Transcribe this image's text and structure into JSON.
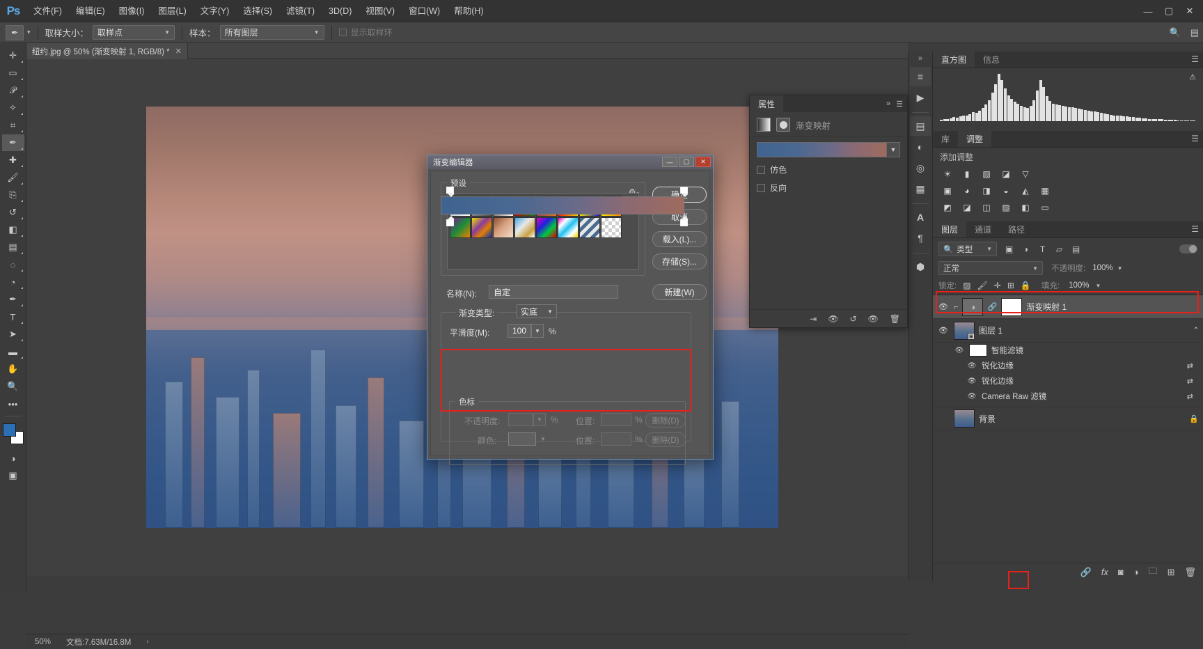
{
  "app": {
    "logo": "Ps"
  },
  "menubar": {
    "items": [
      {
        "label": "文件(F)"
      },
      {
        "label": "编辑(E)"
      },
      {
        "label": "图像(I)"
      },
      {
        "label": "图层(L)"
      },
      {
        "label": "文字(Y)"
      },
      {
        "label": "选择(S)"
      },
      {
        "label": "滤镜(T)"
      },
      {
        "label": "3D(D)"
      },
      {
        "label": "视图(V)"
      },
      {
        "label": "窗口(W)"
      },
      {
        "label": "帮助(H)"
      }
    ],
    "window_controls": {
      "minimize": "—",
      "maximize": "▢",
      "close": "✕"
    }
  },
  "optionsbar": {
    "tool_icon": "eyedropper-icon",
    "sample_size_label": "取样大小：",
    "sample_size_value": "取样点",
    "sample_label": "样本：",
    "sample_value": "所有图层",
    "show_ring_label": "显示取样环",
    "search_icon": "search-icon",
    "arrange_icon": "workspace-icon"
  },
  "toolbar": {
    "tools": [
      {
        "name": "move-tool",
        "glyph": "✛"
      },
      {
        "name": "marquee-tool",
        "glyph": "▭"
      },
      {
        "name": "lasso-tool",
        "glyph": "🄿"
      },
      {
        "name": "quick-select-tool",
        "glyph": "✧"
      },
      {
        "name": "crop-tool",
        "glyph": "⌗"
      },
      {
        "name": "eyedropper-tool",
        "glyph": "✎"
      },
      {
        "name": "healing-brush-tool",
        "glyph": "✚"
      },
      {
        "name": "brush-tool",
        "glyph": "🖌"
      },
      {
        "name": "clone-stamp-tool",
        "glyph": "⎘"
      },
      {
        "name": "history-brush-tool",
        "glyph": "↺"
      },
      {
        "name": "eraser-tool",
        "glyph": "◧"
      },
      {
        "name": "gradient-tool",
        "glyph": "▤"
      },
      {
        "name": "blur-tool",
        "glyph": "◌"
      },
      {
        "name": "dodge-tool",
        "glyph": "🔍"
      },
      {
        "name": "pen-tool",
        "glyph": "✒"
      },
      {
        "name": "type-tool",
        "glyph": "T"
      },
      {
        "name": "path-select-tool",
        "glyph": "➤"
      },
      {
        "name": "shape-tool",
        "glyph": "▬"
      },
      {
        "name": "hand-tool",
        "glyph": "✋"
      },
      {
        "name": "zoom-tool",
        "glyph": "🔎"
      },
      {
        "name": "more-tools",
        "glyph": "•••"
      }
    ],
    "foreground_color": "#2c6fb5",
    "background_color": "#ffffff",
    "quickmask_glyph": "◑",
    "screenmode_glyph": "▣"
  },
  "document": {
    "tab_title": "纽约.jpg @ 50% (渐变映射 1, RGB/8) *",
    "close_glyph": "✕"
  },
  "statusbar": {
    "zoom": "50%",
    "doc_info": "文档:7.63M/16.8M",
    "arrow": "›"
  },
  "dialog": {
    "title": "渐变编辑器",
    "window_controls": {
      "minimize": "—",
      "maximize": "▢",
      "close": "✕"
    },
    "presets_legend": "预设",
    "gear_icon": "gear-icon",
    "presets": [
      {
        "name": "foreground-to-background",
        "css": "linear-gradient(135deg,#7ba0c8 0%,#ffffff 100%)"
      },
      {
        "name": "foreground-to-transparent",
        "css": "linear-gradient(135deg,#9db9d8 0%,rgba(255,255,255,0) 100%)"
      },
      {
        "name": "black-white",
        "css": "linear-gradient(135deg,#000000 0%,#ffffff 100%)"
      },
      {
        "name": "red-green",
        "css": "linear-gradient(135deg,#e00000 0%,#c00000 45%,#0a7a20 100%)"
      },
      {
        "name": "violet-orange",
        "css": "linear-gradient(135deg,#3a1a8c 0%,#7a3a6a 40%,#e07a10 100%)"
      },
      {
        "name": "blue-red-yellow",
        "css": "linear-gradient(135deg,#1414c8 0%,#e81010 45%,#f0d000 100%)"
      },
      {
        "name": "blue-yellow-blue",
        "css": "linear-gradient(135deg,#1414c8 0%,#f0e000 50%,#1414c8 100%)"
      },
      {
        "name": "orange-yellow-orange",
        "css": "linear-gradient(135deg,#f08000 0%,#ffe000 50%,#f08000 100%)"
      },
      {
        "name": "violet-green-orange",
        "css": "linear-gradient(135deg,#7a1a8c 0%,#1a8c3a 50%,#f08000 100%)"
      },
      {
        "name": "yellow-violet-orange-blue",
        "css": "linear-gradient(135deg,#f0e000 0%,#8a3aa0 40%,#e08000 65%,#1030b0 100%)"
      },
      {
        "name": "copper",
        "css": "linear-gradient(135deg,#8a5030 0%,#d8a080 45%,#f0ddc8 100%)"
      },
      {
        "name": "chrome",
        "css": "linear-gradient(135deg,#48a8e0 0%,#e8e8e8 40%,#c8a040 75%,#ffffff 100%)"
      },
      {
        "name": "spectrum",
        "css": "linear-gradient(135deg,#e000c0 0%,#2020e0 35%,#00c840 65%,#e00000 100%)"
      },
      {
        "name": "transparent-rainbow",
        "css": "linear-gradient(135deg,#e000c0 0%,#ffffff 25%,#20c0f0 50%,#ffffff 75%,#f0d000 100%)"
      },
      {
        "name": "transparent-stripes",
        "css": "repeating-linear-gradient(135deg,#4a6a90 0 5px,#e8e8e8 5px 10px)"
      },
      {
        "name": "checkerboard",
        "css": "repeating-conic-gradient(#cfcfcf 0% 25%,#ffffff 0% 50%) 0 0/10px 10px"
      }
    ],
    "name_label": "名称(N):",
    "name_value": "自定",
    "new_button": "新建(W)",
    "gradient_type_label": "渐变类型:",
    "gradient_type_value": "实底",
    "smoothness_label": "平滑度(M):",
    "smoothness_value": "100",
    "smoothness_unit": "%",
    "stops_legend": "色标",
    "opacity_label": "不透明度:",
    "opacity_unit": "%",
    "position_label_1": "位置:",
    "position_unit_1": "%",
    "delete_button_1": "删除(D)",
    "color_label": "颜色:",
    "position_label_2": "位置:",
    "position_unit_2": "%",
    "delete_button_2": "删除(D)",
    "buttons": [
      {
        "name": "ok-button",
        "label": "确定",
        "primary": true
      },
      {
        "name": "cancel-button",
        "label": "取消",
        "primary": false
      },
      {
        "name": "load-button",
        "label": "载入(L)...",
        "primary": false
      },
      {
        "name": "save-button",
        "label": "存储(S)...",
        "primary": false
      }
    ],
    "gradient_css": "linear-gradient(90deg,#3f6490 0%,#4a6892 30%,#6d6a88 58%,#8a6a74 75%,#9e6b5e 100%)",
    "stop_colors": {
      "left": "#ffffff",
      "right": "#ffffff"
    }
  },
  "properties_panel": {
    "tab_label": "属性",
    "collapse_icon": "chevron-double-right-icon",
    "menu_icon": "panel-menu-icon",
    "adjustment_name": "渐变映射",
    "gradient_css": "linear-gradient(90deg,#3f6490 0%,#4a6892 30%,#6d6a88 58%,#8a6a74 75%,#9e6b5e 100%)",
    "checkboxes": [
      {
        "name": "dither-checkbox",
        "label": "仿色",
        "checked": false
      },
      {
        "name": "reverse-checkbox",
        "label": "反向",
        "checked": false
      }
    ],
    "footer_icons": [
      {
        "name": "clip-to-layer-icon",
        "glyph": "⇥"
      },
      {
        "name": "view-previous-icon",
        "glyph": "👁"
      },
      {
        "name": "reset-icon",
        "glyph": "↺"
      },
      {
        "name": "toggle-visibility-icon",
        "glyph": "👁"
      },
      {
        "name": "delete-icon",
        "glyph": "🗑"
      }
    ]
  },
  "histogram_panel": {
    "tabs": [
      {
        "label": "直方图",
        "active": true
      },
      {
        "label": "信息",
        "active": false
      }
    ],
    "warning_icon": "warning-icon",
    "menu_icon": "panel-menu-icon"
  },
  "adjustments_panel": {
    "tabs": [
      {
        "label": "库",
        "active": false
      },
      {
        "label": "调整",
        "active": true
      }
    ],
    "menu_icon": "panel-menu-icon",
    "add_label": "添加调整",
    "row1": [
      "brightness-contrast-icon",
      "levels-icon",
      "curves-icon",
      "exposure-icon",
      "vibrance-icon"
    ],
    "row2": [
      "hue-saturation-icon",
      "color-balance-icon",
      "black-white-icon",
      "photo-filter-icon",
      "channel-mixer-icon",
      "color-lookup-icon"
    ],
    "row3": [
      "invert-icon",
      "posterize-icon",
      "threshold-icon",
      "gradient-map-icon",
      "selective-color-icon",
      "solid-color-icon"
    ]
  },
  "layers_panel": {
    "tabs": [
      {
        "label": "图层",
        "active": true
      },
      {
        "label": "通道",
        "active": false
      },
      {
        "label": "路径",
        "active": false
      }
    ],
    "menu_icon": "panel-menu-icon",
    "filter_value": "类型",
    "filter_icons": [
      "pixel-filter-icon",
      "adjustment-filter-icon",
      "type-filter-icon",
      "shape-filter-icon",
      "smart-object-filter-icon"
    ],
    "blend_mode": "正常",
    "opacity_label": "不透明度:",
    "opacity_value": "100%",
    "lock_label": "锁定:",
    "lock_icons": [
      "lock-transparency-icon",
      "lock-image-icon",
      "lock-position-icon",
      "lock-artboard-icon",
      "lock-all-icon"
    ],
    "fill_label": "填充:",
    "fill_value": "100%",
    "layers": [
      {
        "name": "渐变映射 1",
        "type": "adjustment",
        "selected": true,
        "visible": true,
        "thumb": "gradient-map-thumb",
        "mask": "white-mask",
        "linked": true
      },
      {
        "name": "图层 1",
        "type": "smart-object",
        "selected": false,
        "visible": true,
        "thumb": "photo-thumb"
      },
      {
        "name": "智能滤镜",
        "type": "smart-filter-group",
        "visible": true,
        "thumb": "white-mask"
      },
      {
        "name": "锐化边缘",
        "type": "smart-filter",
        "visible": true
      },
      {
        "name": "锐化边缘",
        "type": "smart-filter",
        "visible": true
      },
      {
        "name": "Camera Raw 滤镜",
        "type": "smart-filter",
        "visible": true
      },
      {
        "name": "背景",
        "type": "background",
        "visible": false,
        "thumb": "photo-thumb",
        "locked": true
      }
    ],
    "footer_icons": [
      {
        "name": "link-layers-icon",
        "glyph": "🔗"
      },
      {
        "name": "layer-style-icon",
        "glyph": "fx"
      },
      {
        "name": "layer-mask-icon",
        "glyph": "◙"
      },
      {
        "name": "new-adjustment-layer-icon",
        "glyph": "◑",
        "highlighted": true
      },
      {
        "name": "new-group-icon",
        "glyph": "🗀"
      },
      {
        "name": "new-layer-icon",
        "glyph": "⊞"
      },
      {
        "name": "delete-layer-icon",
        "glyph": "🗑"
      }
    ]
  },
  "rail": {
    "collapse_icon": "chevron-double-right-icon",
    "buttons": [
      {
        "name": "rail-history-icon",
        "glyph": "≡"
      },
      {
        "name": "rail-actions-icon",
        "glyph": "▶"
      },
      {
        "name": "rail-properties-icon",
        "glyph": "▤"
      },
      {
        "name": "rail-adjustments-icon",
        "glyph": "◐"
      },
      {
        "name": "rail-styles-icon",
        "glyph": "◎"
      },
      {
        "name": "rail-swatches-icon",
        "glyph": "▦"
      },
      {
        "name": "rail-character-icon",
        "glyph": "A"
      },
      {
        "name": "rail-paragraph-icon",
        "glyph": "¶"
      },
      {
        "name": "rail-3d-icon",
        "glyph": "⬢"
      }
    ]
  },
  "highlight_color": "#e8201c"
}
